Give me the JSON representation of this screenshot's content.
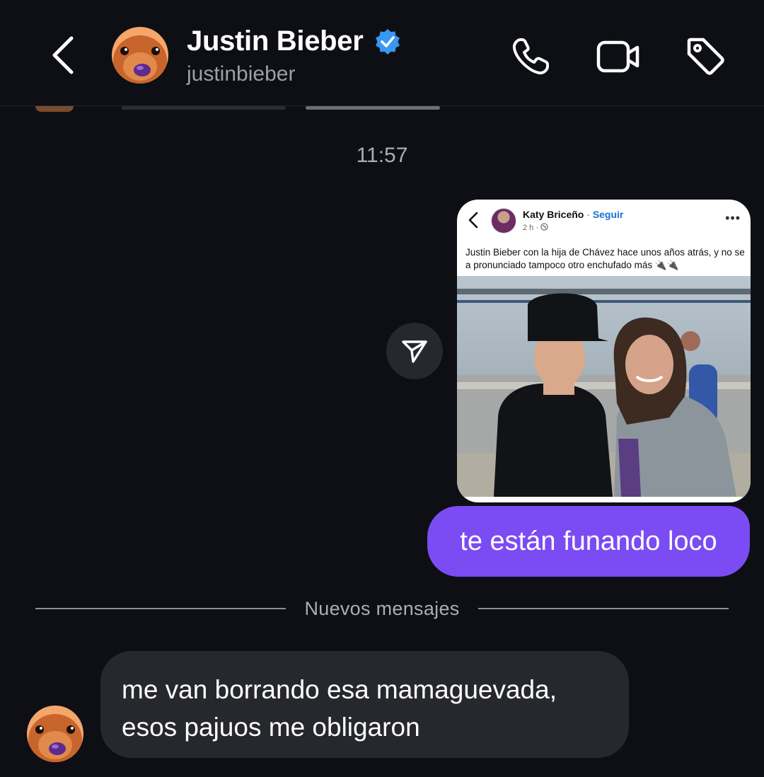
{
  "header": {
    "contact_name": "Justin Bieber",
    "contact_handle": "justinbieber",
    "verified": true,
    "icons": [
      "back-icon",
      "phone-icon",
      "video-camera-icon",
      "tag-icon"
    ]
  },
  "thread": {
    "timestamp": "11:57",
    "shared_post": {
      "author": "Katy Briceño",
      "separator": " · ",
      "follow_label": "Seguir",
      "time": "2 h · ",
      "text": "Justin Bieber con la hija de Chávez hace unos años atrás, y no se a pronunciado tampoco otro enchufado más 🔌🔌"
    },
    "outgoing_message": "te están funando loco",
    "new_messages_label": "Nuevos mensajes",
    "incoming_message": {
      "line1": "me van borrando esa mamaguevada,",
      "line2": "esos pajuos me obligaron"
    }
  },
  "colors": {
    "background": "#0d0f14",
    "outgoing_bubble": "#7b4bf3",
    "incoming_bubble": "#26282d",
    "verified_badge": "#3897f0"
  }
}
